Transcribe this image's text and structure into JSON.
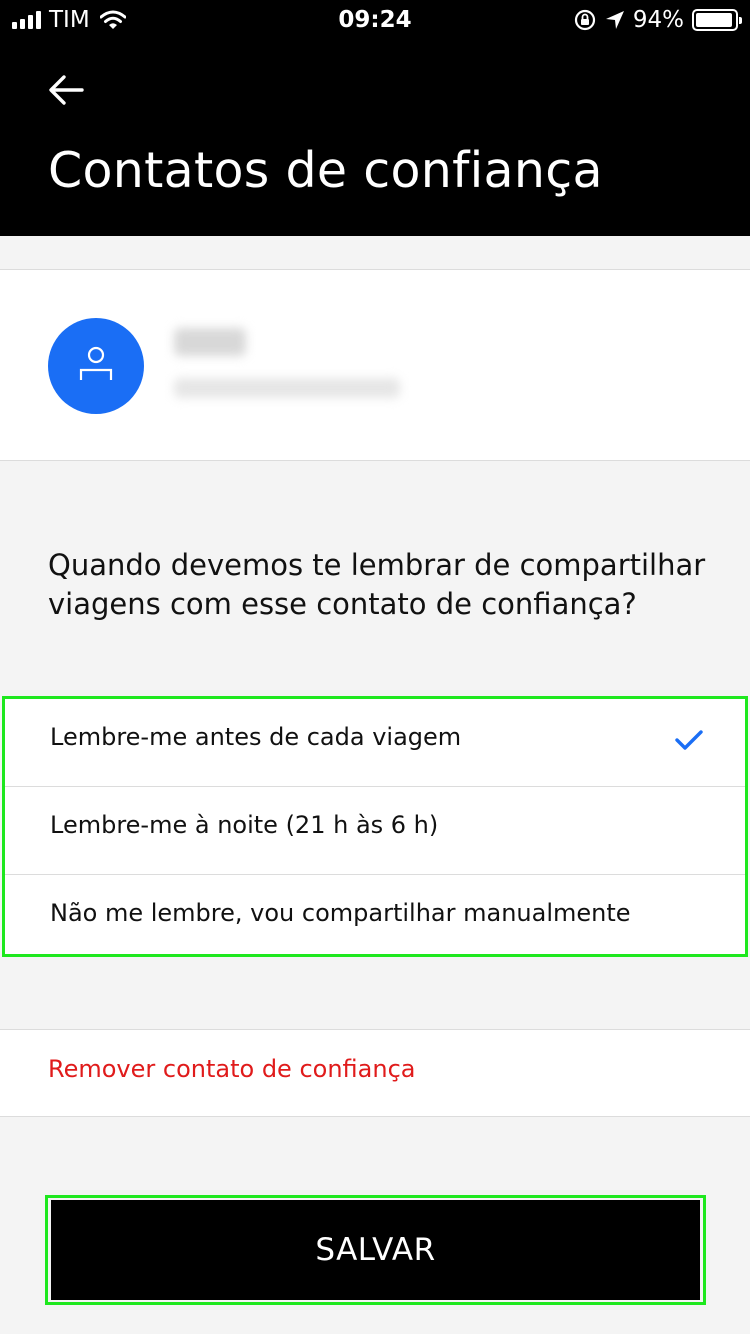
{
  "status_bar": {
    "carrier": "TIM",
    "time": "09:24",
    "battery": "94%",
    "battery_level": 0.94,
    "icons": [
      "signal-icon",
      "wifi-icon",
      "rotation-lock-icon",
      "location-arrow-icon",
      "battery-icon"
    ]
  },
  "header": {
    "back_icon": "arrow-left-icon",
    "title": "Contatos de confiança"
  },
  "contact": {
    "avatar_icon": "person-icon",
    "avatar_color": "#1a6ef5"
  },
  "reminder": {
    "question": "Quando devemos te lembrar de compartilhar viagens com esse contato de confiança?",
    "options": [
      {
        "label": "Lembre-me antes de cada viagem",
        "selected": true
      },
      {
        "label": "Lembre-me à noite (21 h às 6 h)",
        "selected": false
      },
      {
        "label": "Não me lembre, vou compartilhar manualmente",
        "selected": false
      }
    ],
    "check_icon": "checkmark-icon",
    "check_color": "#1a6ef5"
  },
  "actions": {
    "remove_label": "Remover contato de confiança",
    "remove_color": "#e01b1b",
    "save_label": "SALVAR"
  },
  "highlight_color": "#1ee81e"
}
